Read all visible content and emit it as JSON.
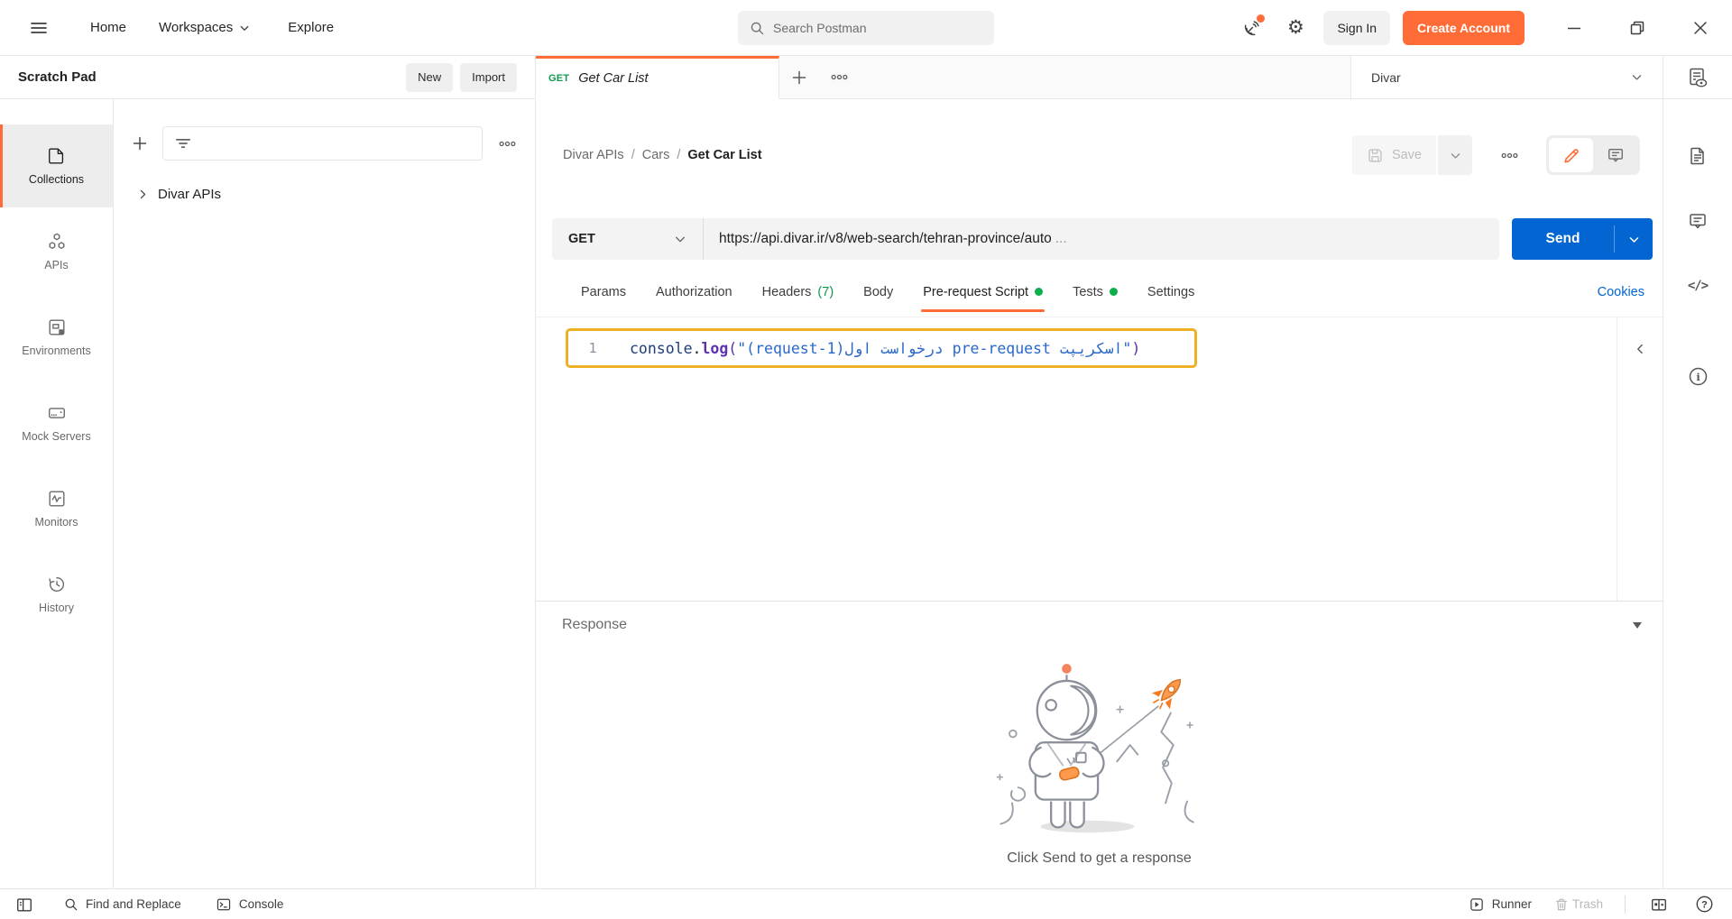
{
  "topbar": {
    "home": "Home",
    "workspaces": "Workspaces",
    "explore": "Explore",
    "search_placeholder": "Search Postman",
    "sign_in": "Sign In",
    "create_account": "Create Account"
  },
  "sidebar": {
    "title": "Scratch Pad",
    "new_button": "New",
    "import_button": "Import",
    "nav": [
      {
        "label": "Collections",
        "active": true
      },
      {
        "label": "APIs"
      },
      {
        "label": "Environments"
      },
      {
        "label": "Mock Servers"
      },
      {
        "label": "Monitors"
      },
      {
        "label": "History"
      }
    ],
    "collection_name": "Divar APIs"
  },
  "request": {
    "tab": {
      "method": "GET",
      "title": "Get Car List"
    },
    "environment": "Divar",
    "breadcrumb": {
      "collection": "Divar APIs",
      "sep": "/",
      "folder": "Cars",
      "name": "Get Car List"
    },
    "save_label": "Save",
    "method": "GET",
    "url": "https://api.divar.ir/v8/web-search/tehran-province/auto",
    "url_ellipsis": "...",
    "send_label": "Send",
    "tabs": [
      {
        "label": "Params"
      },
      {
        "label": "Authorization"
      },
      {
        "label": "Headers",
        "count": "(7)"
      },
      {
        "label": "Body"
      },
      {
        "label": "Pre-request Script",
        "dot": true,
        "active": true
      },
      {
        "label": "Tests",
        "dot": true
      },
      {
        "label": "Settings"
      }
    ],
    "cookies_link": "Cookies"
  },
  "editor": {
    "line_number": "1",
    "code": {
      "object": "console",
      "dot": ".",
      "method": "log",
      "paren_open": "(",
      "quote_open": "\"",
      "string_rtl": "اسکریپت pre-request درخواست اول(request-1)",
      "quote_close": "\"",
      "paren_close": ")"
    }
  },
  "response": {
    "label": "Response",
    "empty_text": "Click Send to get a response"
  },
  "statusbar": {
    "find_label": "Find and Replace",
    "console_label": "Console",
    "runner_label": "Runner",
    "trash_label": "Trash"
  },
  "icons": {
    "gear": "⚙",
    "code": "</>",
    "info": "i",
    "help": "?"
  },
  "colors": {
    "accent_orange": "#ff6c37",
    "send_blue": "#0265d2",
    "link_blue": "#0265d2",
    "green_text": "#0e9a4e",
    "green_dot": "#0caf49",
    "highlight_border": "#eeb024"
  }
}
